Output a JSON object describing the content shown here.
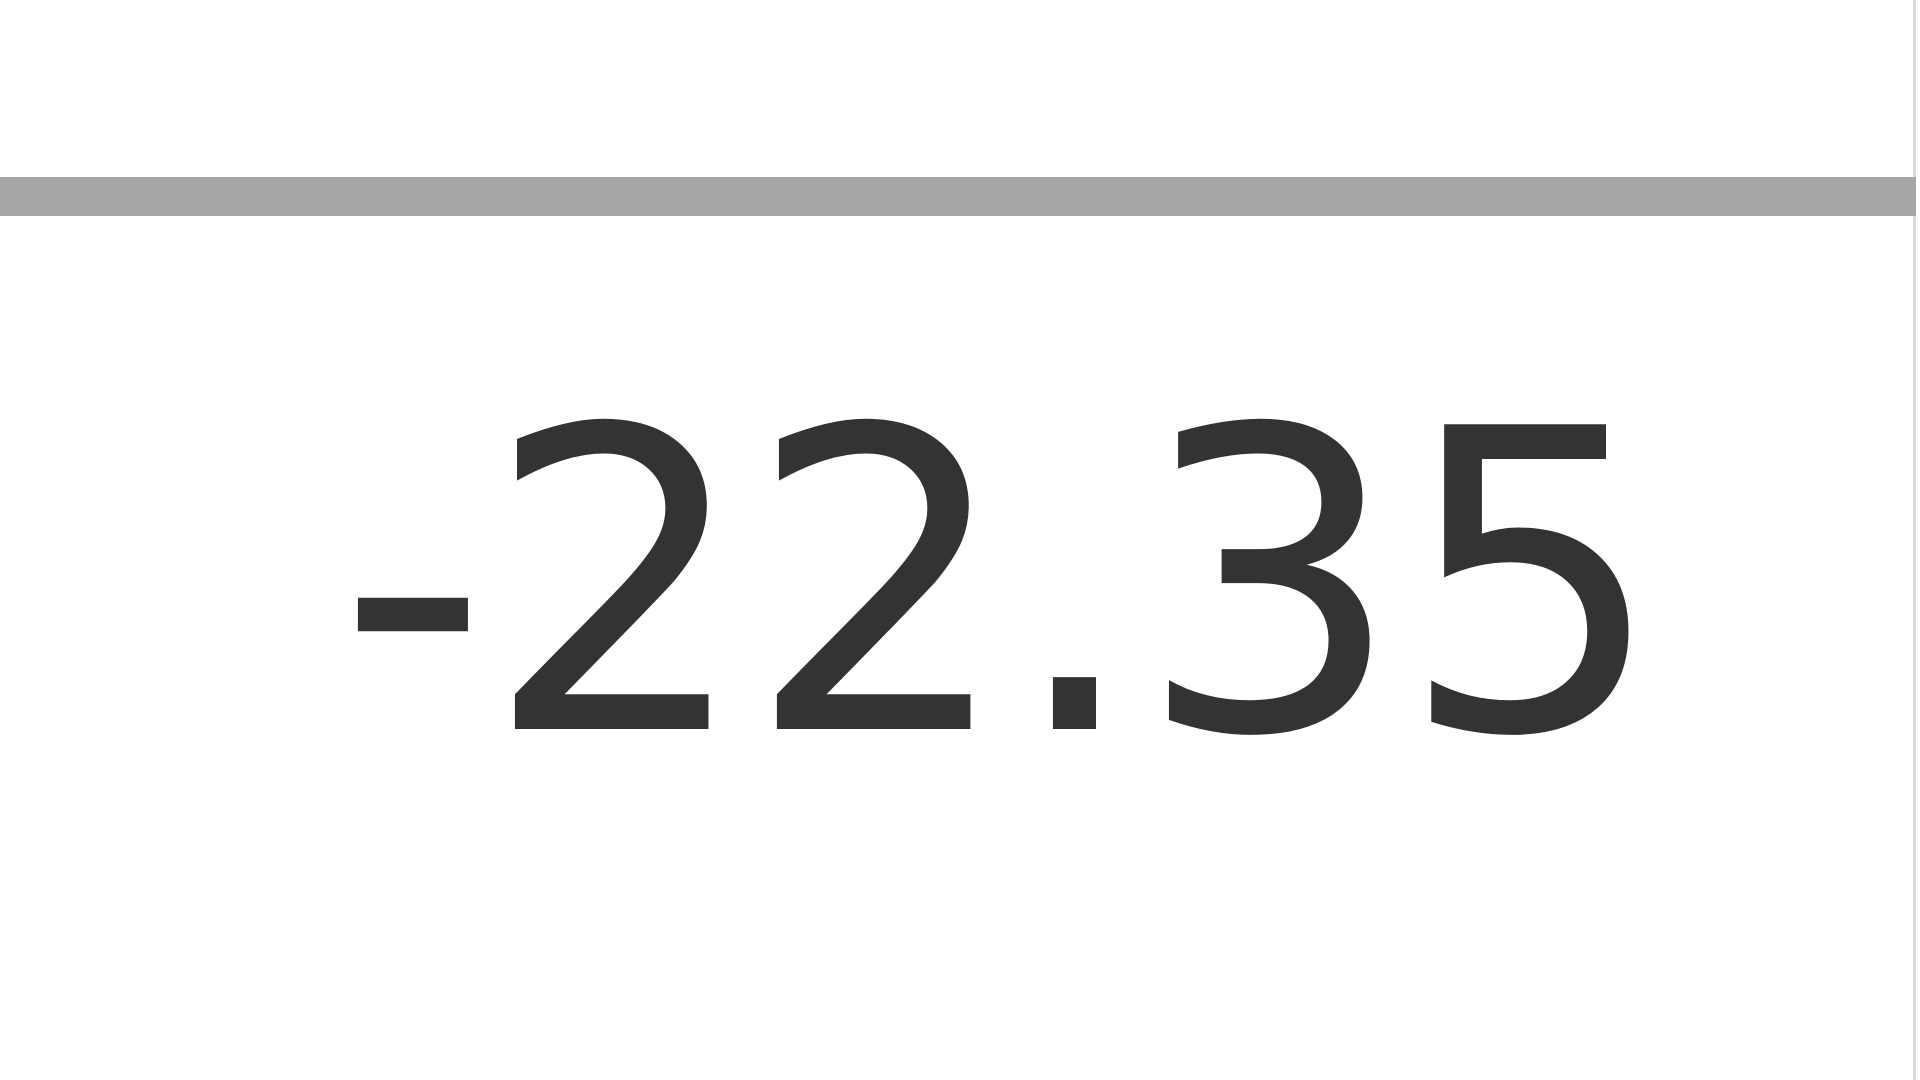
{
  "cell": {
    "value": "-22.35"
  }
}
